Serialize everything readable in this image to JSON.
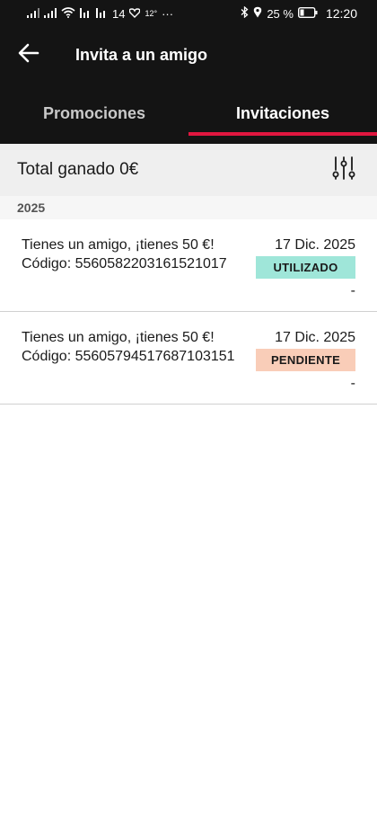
{
  "status_bar": {
    "left_number": "14",
    "temperature": "12°",
    "more": "···",
    "battery": "25 %",
    "time": "12:20"
  },
  "header": {
    "title": "Invita a un amigo",
    "tabs": [
      {
        "label": "Promociones",
        "active": false
      },
      {
        "label": "Invitaciones",
        "active": true
      }
    ]
  },
  "summary": {
    "total_label": "Total ganado 0€"
  },
  "year_label": "2025",
  "invitations": [
    {
      "title": "Tienes un amigo, ¡tienes 50 €!",
      "code": "Código: 5560582203161521017",
      "date": "17 Dic. 2025",
      "status": "UTILIZADO",
      "status_color": "#9fe6d9",
      "amount": "-"
    },
    {
      "title": "Tienes un amigo, ¡tienes 50 €!",
      "code": "Código: 55605794517687103151",
      "date": "17 Dic. 2025",
      "status": "PENDIENTE",
      "status_color": "#f9cdb8",
      "amount": "-"
    }
  ],
  "colors": {
    "header_bg": "#141414",
    "tab_indicator": "#e0163f",
    "summary_bg": "#efefef"
  }
}
